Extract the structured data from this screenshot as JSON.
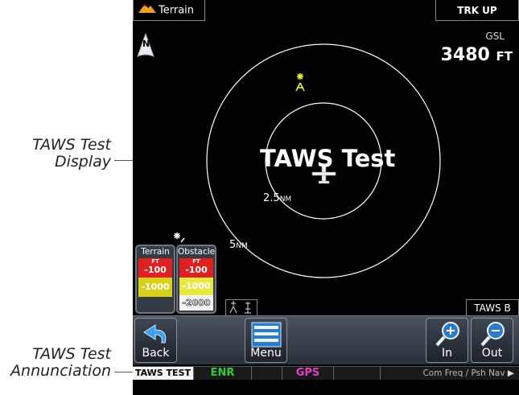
{
  "callouts": {
    "display_line1": "TAWS Test",
    "display_line2": "Display",
    "annunciation_line1": "TAWS Test",
    "annunciation_line2": "Annunciation"
  },
  "header": {
    "page_title": "Terrain",
    "orientation": "TRK UP",
    "north": "N"
  },
  "gsl": {
    "label": "GSL",
    "value": "3480",
    "unit": "FT"
  },
  "map": {
    "taws_test_text": "TAWS Test",
    "ring_inner_value": "2.5",
    "ring_inner_unit": "NM",
    "ring_outer_value": "5",
    "ring_outer_unit": "NM",
    "taws_mode": "TAWS B"
  },
  "legend_terrain": {
    "title": "Terrain",
    "ft": "FT",
    "levels": [
      "-100",
      "-1000"
    ]
  },
  "legend_obstacle": {
    "title": "Obstacle",
    "ft": "FT",
    "levels": [
      "-100",
      "-1000",
      "-2000"
    ]
  },
  "buttons": {
    "back": "Back",
    "menu": "Menu",
    "zoom_in": "In",
    "zoom_out": "Out"
  },
  "status_bar": {
    "annunciation": "TAWS TEST",
    "enr": "ENR",
    "gps": "GPS",
    "com_freq": "Com Freq / Psh Nav"
  },
  "colors": {
    "red": "#e02020",
    "yellow": "#d8cf1a",
    "enr_green": "#2ecc40",
    "gps_magenta": "#e040c0",
    "obstacle_yellow": "#e8e840"
  }
}
